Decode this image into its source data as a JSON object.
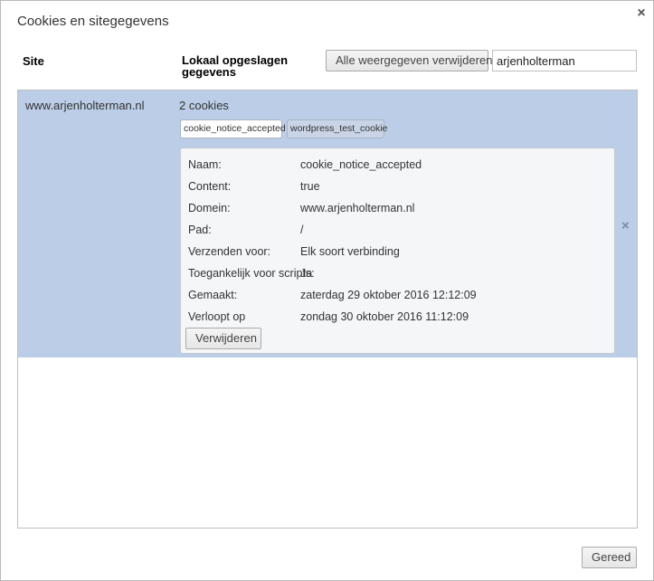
{
  "dialog": {
    "title": "Cookies en sitegegevens",
    "close_glyph": "×"
  },
  "header": {
    "site_col": "Site",
    "local_col": "Lokaal opgeslagen gegevens",
    "remove_all_label": "Alle weergegeven verwijderen",
    "search_value": "arjenholterman"
  },
  "rows": [
    {
      "site": "www.arjenholterman.nl",
      "count": "2 cookies",
      "cookies": [
        "cookie_notice_accepted",
        "wordpress_test_cookie"
      ],
      "remove_glyph": "×",
      "details": {
        "name_label": "Naam:",
        "name_value": "cookie_notice_accepted",
        "content_label": "Content:",
        "content_value": "true",
        "domain_label": "Domein:",
        "domain_value": "www.arjenholterman.nl",
        "path_label": "Pad:",
        "path_value": "/",
        "send_label": "Verzenden voor:",
        "send_value": "Elk soort verbinding",
        "script_label": "Toegankelijk voor scripts:",
        "script_value": "Ja",
        "created_label": "Gemaakt:",
        "created_value": "zaterdag 29 oktober 2016 12:12:09",
        "expires_label": "Verloopt op",
        "expires_value": "zondag 30 oktober 2016 11:12:09",
        "remove_label": "Verwijderen"
      }
    }
  ],
  "footer": {
    "done_label": "Gereed"
  },
  "colors": {
    "selected_row": "#bbcde7",
    "details_bg": "#f4f6f8"
  }
}
